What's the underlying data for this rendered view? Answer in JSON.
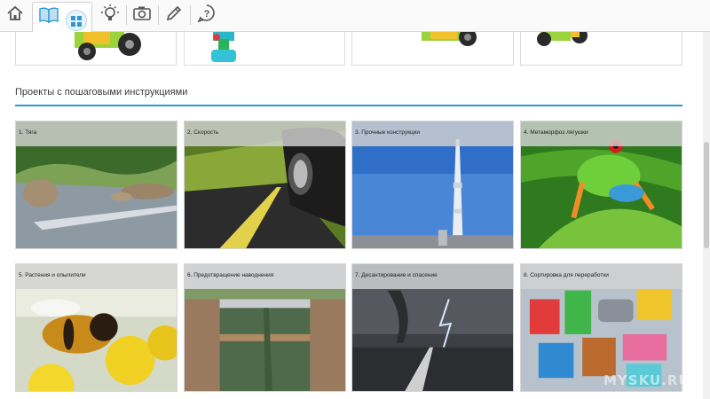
{
  "toolbar": {
    "items": [
      {
        "icon": "home-icon"
      },
      {
        "icon": "book-icon"
      },
      {
        "icon": "grid-icon"
      },
      {
        "icon": "lightbulb-icon"
      },
      {
        "icon": "camera-icon"
      },
      {
        "icon": "pencil-icon"
      },
      {
        "icon": "help-icon"
      }
    ],
    "accent": "#2b98d4"
  },
  "section": {
    "title": "Проекты с пошаговыми инструкциями"
  },
  "projects": [
    {
      "label": "1. Тяга"
    },
    {
      "label": "2. Скорость"
    },
    {
      "label": "3. Прочные конструкции"
    },
    {
      "label": "4. Метаморфоз лягушки"
    },
    {
      "label": "5. Растения и опылители"
    },
    {
      "label": "6. Предотвращение наводнения"
    },
    {
      "label": "7. Десантирование и спасение"
    },
    {
      "label": "8. Сортировка для переработки"
    }
  ],
  "watermark": "MYSKU.RU"
}
